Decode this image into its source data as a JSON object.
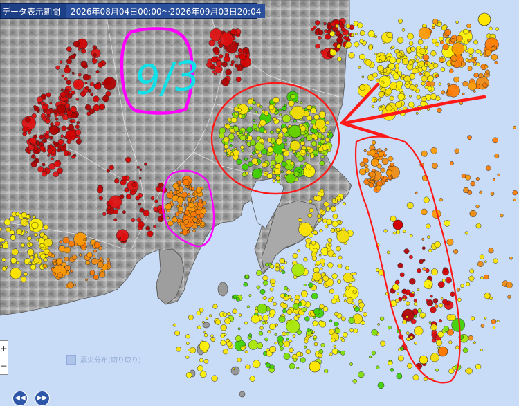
{
  "header": {
    "label": "データ表示期間",
    "range": "2026年08月04日00:00〜2026年09月03日20:04"
  },
  "annotation": {
    "date_text": "9/3"
  },
  "zoom": {
    "in_label": "+",
    "out_label": "−"
  },
  "nav": {
    "prev_label": "◀◀",
    "next_label": "▶▶"
  },
  "watermark": {
    "text": "震央分布(切り取り)"
  },
  "colors": {
    "sea": "#c9dcf7",
    "land_high": "#8a8a8a",
    "land_low": "#b7b7b7",
    "annotation_magenta": "#ff00ff",
    "annotation_cyan": "#11e0e8",
    "annotation_red": "#ff1a1a"
  }
}
